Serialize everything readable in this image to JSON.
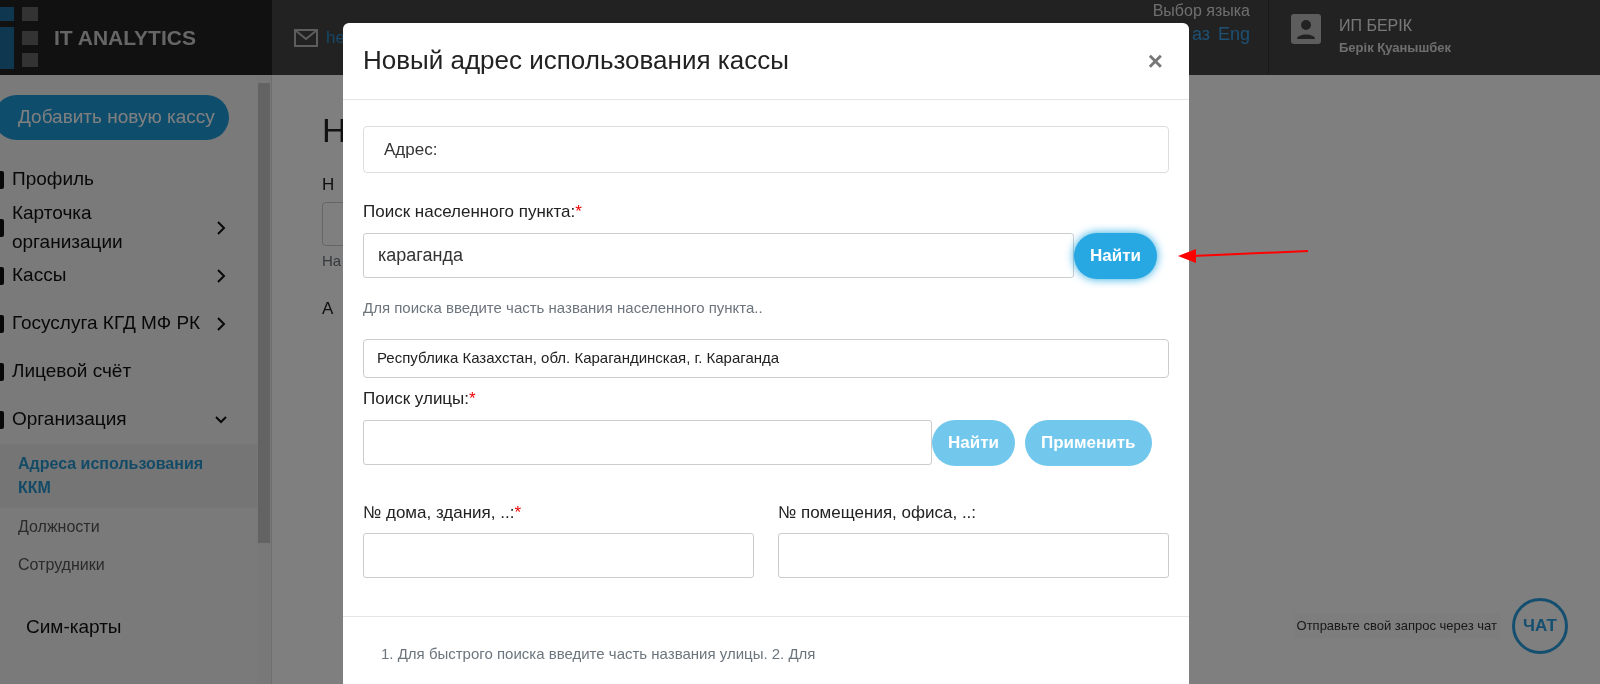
{
  "header": {
    "logo": "IT ANALYTICS",
    "email": "he",
    "language_label": "Выбор языка",
    "languages": [
      "аз",
      "Eng"
    ],
    "user": {
      "name": "ИП БЕРІК",
      "subtitle": "Берік Қуанышбек"
    }
  },
  "sidebar": {
    "add_button": "Добавить новую кассу",
    "items": [
      {
        "label": "Профиль",
        "kind": "link"
      },
      {
        "label": "Карточка организации",
        "kind": "group",
        "expanded": false
      },
      {
        "label": "Кассы",
        "kind": "group",
        "expanded": false
      },
      {
        "label": "Госуслуга КГД МФ РК",
        "kind": "group",
        "expanded": false
      },
      {
        "label": "Лицевой счёт",
        "kind": "link"
      },
      {
        "label": "Организация",
        "kind": "group",
        "expanded": true,
        "children": [
          {
            "label": "Адреса использования ККМ",
            "selected": true
          },
          {
            "label": "Должности",
            "selected": false
          },
          {
            "label": "Сотрудники",
            "selected": false
          }
        ]
      },
      {
        "label": "Сим-карты",
        "kind": "plain"
      }
    ]
  },
  "background_page": {
    "heading": "Н",
    "field_label": "Н",
    "hint": "На",
    "field_label_2": "А"
  },
  "modal": {
    "title": "Новый адрес использования кассы",
    "close": "×",
    "address_label": "Адрес:",
    "city": {
      "label": "Поиск населенного пункта:",
      "required_mark": "*",
      "value": "караганда",
      "button": {
        "label": "Найти",
        "disabled": false
      },
      "hint": "Для поиска введите часть названия населенного пункта..",
      "result": "Республика Казахстан, обл. Карагандинская, г. Караганда"
    },
    "street": {
      "label": "Поиск улицы:",
      "required_mark": "*",
      "buttons": [
        {
          "label": "Найти",
          "disabled": true
        },
        {
          "label": "Применить",
          "disabled": true
        }
      ]
    },
    "house": {
      "label": "№ дома, здания, ..:",
      "required_mark": "*"
    },
    "office": {
      "label": "№ помещения, офиса, ..:"
    },
    "footer_note": "1. Для быстрого поиска введите часть названия улицы. 2. Для"
  },
  "chat": {
    "prompt": "Отправьте свой запрос через чат",
    "button": "ЧАТ"
  }
}
